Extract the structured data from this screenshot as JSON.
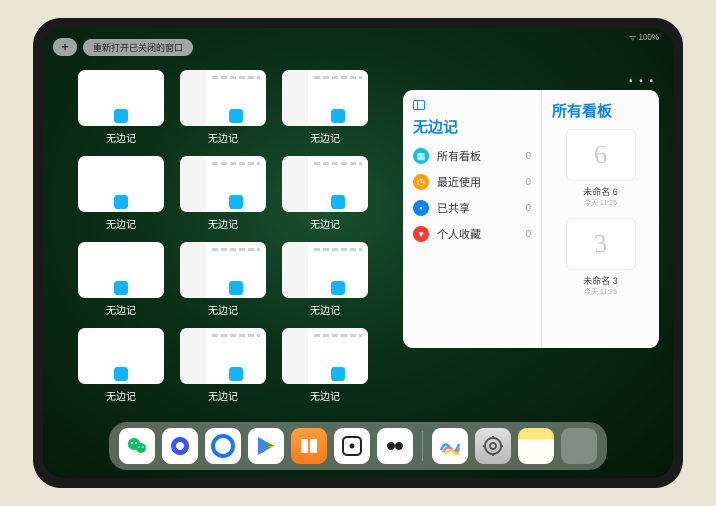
{
  "status": "100%",
  "topbar": {
    "plus_label": "+",
    "reopen_label": "重新打开已关闭的窗口"
  },
  "app_name": "无边记",
  "windows": [
    {
      "label": "无边记",
      "variant": "blank"
    },
    {
      "label": "无边记",
      "variant": "calendar"
    },
    {
      "label": "无边记",
      "variant": "calendar"
    },
    {
      "label": "无边记",
      "variant": "blank"
    },
    {
      "label": "无边记",
      "variant": "calendar"
    },
    {
      "label": "无边记",
      "variant": "calendar"
    },
    {
      "label": "无边记",
      "variant": "blank"
    },
    {
      "label": "无边记",
      "variant": "calendar"
    },
    {
      "label": "无边记",
      "variant": "calendar"
    },
    {
      "label": "无边记",
      "variant": "blank"
    },
    {
      "label": "无边记",
      "variant": "calendar"
    },
    {
      "label": "无边记",
      "variant": "calendar"
    }
  ],
  "panel": {
    "title": "无边记",
    "nav": [
      {
        "label": "所有看板",
        "count": "0",
        "color": "#14c1d9",
        "icon": "grid"
      },
      {
        "label": "最近使用",
        "count": "0",
        "color": "#ff9f0a",
        "icon": "clock"
      },
      {
        "label": "已共享",
        "count": "0",
        "color": "#0a84ff",
        "icon": "person"
      },
      {
        "label": "个人收藏",
        "count": "0",
        "color": "#ff3b30",
        "icon": "heart"
      }
    ],
    "right_title": "所有看板",
    "boards": [
      {
        "glyph": "6",
        "label": "未命名 6",
        "sub": "今天 11:25"
      },
      {
        "glyph": "3",
        "label": "未命名 3",
        "sub": "今天 11:25"
      }
    ]
  },
  "dock": {
    "icons": [
      {
        "name": "wechat",
        "color": "#07c160"
      },
      {
        "name": "quark",
        "color": "#3955ff"
      },
      {
        "name": "alipay",
        "color": "#1677ff"
      },
      {
        "name": "play",
        "color": "#34a853"
      },
      {
        "name": "books",
        "color": "#ff7a1a"
      },
      {
        "name": "weread",
        "color": "#222"
      },
      {
        "name": "infinite",
        "color": "#222"
      },
      {
        "name": "freeform",
        "color": "#0fb5ff"
      },
      {
        "name": "settings",
        "color": "#555"
      },
      {
        "name": "notes",
        "color": "#ffe67a"
      },
      {
        "name": "app-library",
        "color": "#888"
      }
    ]
  }
}
